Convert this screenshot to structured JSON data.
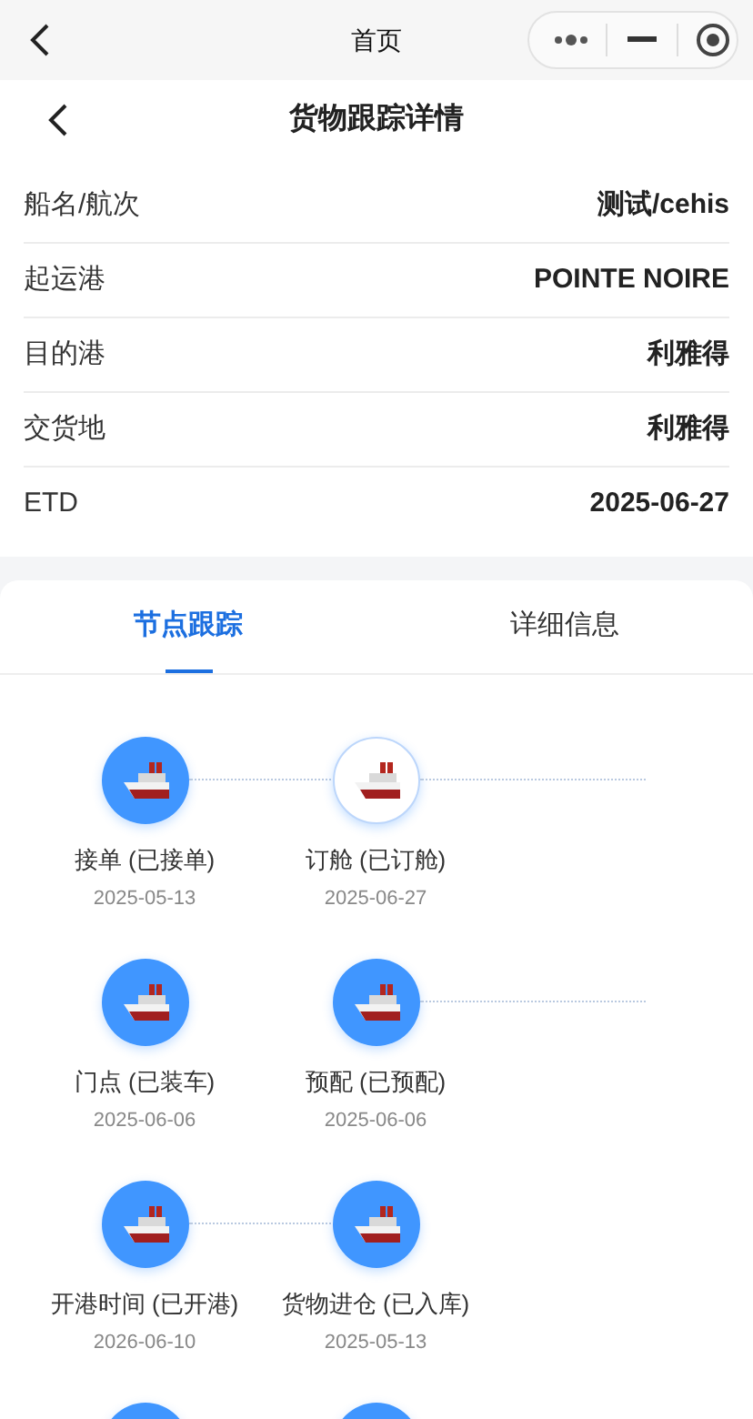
{
  "top_bar": {
    "title": "首页"
  },
  "header": {
    "title": "货物跟踪详情"
  },
  "info_rows": [
    {
      "label": "船名/航次",
      "value": "测试/cehis"
    },
    {
      "label": "起运港",
      "value": "POINTE NOIRE"
    },
    {
      "label": "目的港",
      "value": "利雅得"
    },
    {
      "label": "交货地",
      "value": "利雅得"
    },
    {
      "label": "ETD",
      "value": "2025-06-27"
    }
  ],
  "tabs": [
    {
      "label": "节点跟踪",
      "selected": true
    },
    {
      "label": "详细信息",
      "selected": false
    }
  ],
  "nodes": [
    {
      "label": "接单 (已接单)",
      "date": "2025-05-13",
      "done": true,
      "connector": true
    },
    {
      "label": "订舱 (已订舱)",
      "date": "2025-06-27",
      "done": false,
      "connector": true
    },
    {
      "label": "门点 (已装车)",
      "date": "2025-06-06",
      "done": true,
      "connector": false
    },
    {
      "label": "预配 (已预配)",
      "date": "2025-06-06",
      "done": true,
      "connector": true
    },
    {
      "label": "开港时间 (已开港)",
      "date": "2026-06-10",
      "done": true,
      "connector": true
    },
    {
      "label": "货物进仓 (已入库)",
      "date": "2025-05-13",
      "done": true,
      "connector": false
    },
    {
      "done": true,
      "connector": false
    },
    {
      "done": true,
      "connector": false
    }
  ]
}
